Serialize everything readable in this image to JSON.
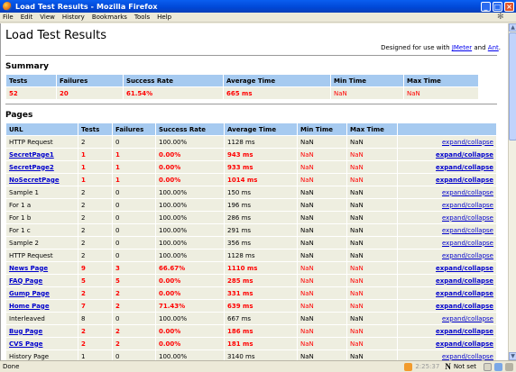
{
  "window": {
    "title": "Load Test Results - Mozilla Firefox",
    "buttons": {
      "minimize": "_",
      "maximize": "□",
      "close": "×"
    }
  },
  "menu": [
    "File",
    "Edit",
    "View",
    "History",
    "Bookmarks",
    "Tools",
    "Help"
  ],
  "page": {
    "title": "Load Test Results",
    "designed_prefix": "Designed for use with ",
    "designed_link1": "JMeter",
    "designed_and": " and ",
    "designed_link2": "Ant",
    "designed_suffix": "."
  },
  "summary": {
    "heading": "Summary",
    "headers": [
      "Tests",
      "Failures",
      "Success Rate",
      "Average Time",
      "Min Time",
      "Max Time"
    ],
    "row": [
      "52",
      "20",
      "61.54%",
      "665 ms",
      "NaN",
      "NaN"
    ]
  },
  "pages": {
    "heading": "Pages",
    "headers": [
      "URL",
      "Tests",
      "Failures",
      "Success Rate",
      "Average Time",
      "Min Time",
      "Max Time",
      ""
    ],
    "action_label": "expand/collapse",
    "rows": [
      {
        "url": "HTTP Request",
        "tests": "2",
        "failures": "0",
        "rate": "100.00%",
        "avg": "1128 ms",
        "min": "NaN",
        "max": "NaN",
        "bad": false
      },
      {
        "url": "SecretPage1",
        "tests": "1",
        "failures": "1",
        "rate": "0.00%",
        "avg": "943 ms",
        "min": "NaN",
        "max": "NaN",
        "bad": true
      },
      {
        "url": "SecretPage2",
        "tests": "1",
        "failures": "1",
        "rate": "0.00%",
        "avg": "933 ms",
        "min": "NaN",
        "max": "NaN",
        "bad": true
      },
      {
        "url": "NoSecretPage",
        "tests": "1",
        "failures": "1",
        "rate": "0.00%",
        "avg": "1014 ms",
        "min": "NaN",
        "max": "NaN",
        "bad": true
      },
      {
        "url": "Sample 1",
        "tests": "2",
        "failures": "0",
        "rate": "100.00%",
        "avg": "150 ms",
        "min": "NaN",
        "max": "NaN",
        "bad": false
      },
      {
        "url": "For 1 a",
        "tests": "2",
        "failures": "0",
        "rate": "100.00%",
        "avg": "196 ms",
        "min": "NaN",
        "max": "NaN",
        "bad": false
      },
      {
        "url": "For 1 b",
        "tests": "2",
        "failures": "0",
        "rate": "100.00%",
        "avg": "286 ms",
        "min": "NaN",
        "max": "NaN",
        "bad": false
      },
      {
        "url": "For 1 c",
        "tests": "2",
        "failures": "0",
        "rate": "100.00%",
        "avg": "291 ms",
        "min": "NaN",
        "max": "NaN",
        "bad": false
      },
      {
        "url": "Sample 2",
        "tests": "2",
        "failures": "0",
        "rate": "100.00%",
        "avg": "356 ms",
        "min": "NaN",
        "max": "NaN",
        "bad": false
      },
      {
        "url": "HTTP Request",
        "tests": "2",
        "failures": "0",
        "rate": "100.00%",
        "avg": "1128 ms",
        "min": "NaN",
        "max": "NaN",
        "bad": false
      },
      {
        "url": "News Page",
        "tests": "9",
        "failures": "3",
        "rate": "66.67%",
        "avg": "1110 ms",
        "min": "NaN",
        "max": "NaN",
        "bad": true
      },
      {
        "url": "FAQ Page",
        "tests": "5",
        "failures": "5",
        "rate": "0.00%",
        "avg": "285 ms",
        "min": "NaN",
        "max": "NaN",
        "bad": true
      },
      {
        "url": "Gump Page",
        "tests": "2",
        "failures": "2",
        "rate": "0.00%",
        "avg": "331 ms",
        "min": "NaN",
        "max": "NaN",
        "bad": true
      },
      {
        "url": "Home Page",
        "tests": "7",
        "failures": "2",
        "rate": "71.43%",
        "avg": "639 ms",
        "min": "NaN",
        "max": "NaN",
        "bad": true
      },
      {
        "url": "Interleaved",
        "tests": "8",
        "failures": "0",
        "rate": "100.00%",
        "avg": "667 ms",
        "min": "NaN",
        "max": "NaN",
        "bad": false
      },
      {
        "url": "Bug Page",
        "tests": "2",
        "failures": "2",
        "rate": "0.00%",
        "avg": "186 ms",
        "min": "NaN",
        "max": "NaN",
        "bad": true
      },
      {
        "url": "CVS Page",
        "tests": "2",
        "failures": "2",
        "rate": "0.00%",
        "avg": "181 ms",
        "min": "NaN",
        "max": "NaN",
        "bad": true
      },
      {
        "url": "History Page",
        "tests": "1",
        "failures": "0",
        "rate": "100.00%",
        "avg": "3140 ms",
        "min": "NaN",
        "max": "NaN",
        "bad": false
      }
    ]
  },
  "status": {
    "text": "Done",
    "clock": "2:25:37",
    "noscript": "Not set"
  }
}
